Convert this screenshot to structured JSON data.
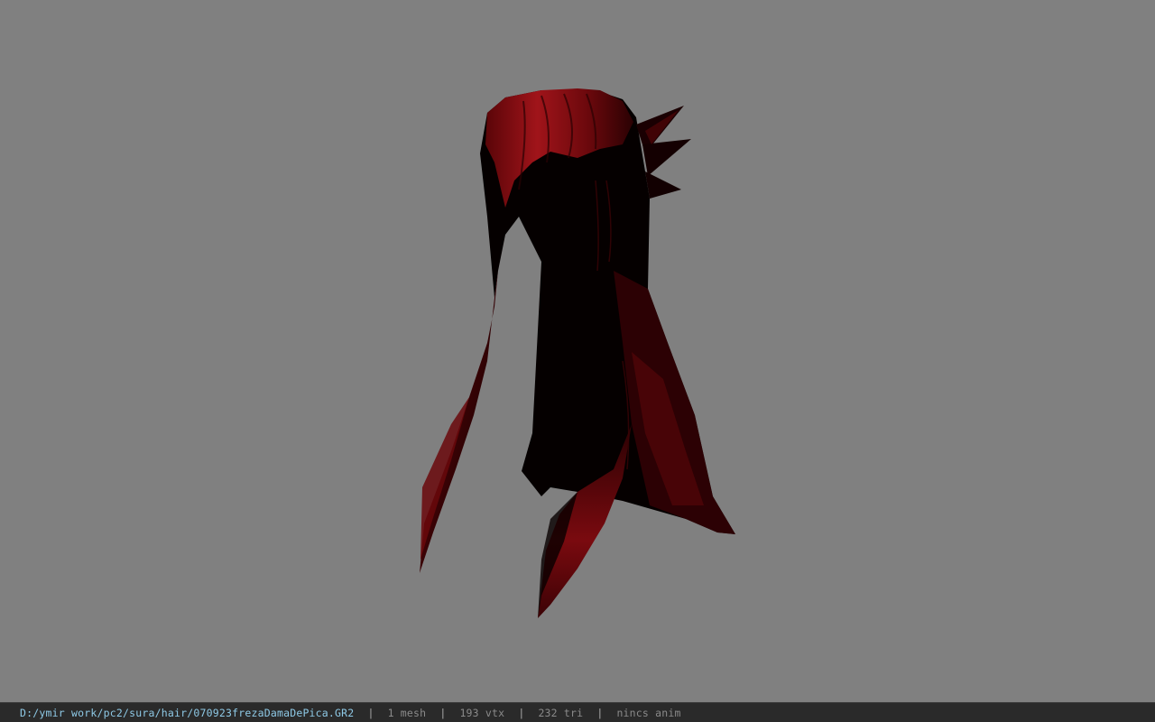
{
  "viewer": {
    "background_color": "#808080",
    "model": {
      "subject": "red hair mesh",
      "colors": {
        "base": "#050000",
        "dark_red": "#3a0205",
        "red": "#7a0a0f",
        "highlight": "#a0141a"
      }
    }
  },
  "statusbar": {
    "file_path": "D:/ymir work/pc2/sura/hair/070923frezaDamaDePica.GR2",
    "separator": "|",
    "mesh_count": "1 mesh",
    "vertex_count": "193 vtx",
    "triangle_count": "232 tri",
    "anim_status": "nincs anim",
    "path_color": "#8ec9e6"
  }
}
